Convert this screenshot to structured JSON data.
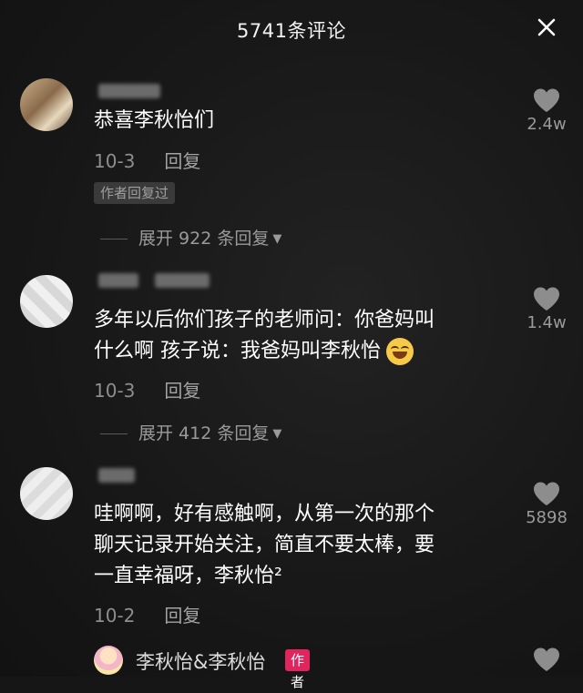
{
  "header": {
    "title": "5741条评论"
  },
  "comments": [
    {
      "text_lines": [
        "恭喜李秋怡们"
      ],
      "date": "10-3",
      "reply_label": "回复",
      "author_badge": "作者回复过",
      "expand_label": "展开 922 条回复",
      "likes": "2.4w"
    },
    {
      "text_lines": [
        "多年以后你们孩子的老师问：你爸妈叫",
        "什么啊 孩子说：我爸妈叫李秋怡"
      ],
      "date": "10-3",
      "reply_label": "回复",
      "expand_label": "展开 412 条回复",
      "likes": "1.4w"
    },
    {
      "text_lines": [
        "哇啊啊，好有感触啊，从第一次的那个",
        "聊天记录开始关注，简直不要太棒，要",
        "一直幸福呀，李秋怡²"
      ],
      "date": "10-2",
      "reply_label": "回复",
      "likes": "5898"
    }
  ],
  "author_reply": {
    "name": "李秋怡&李秋怡",
    "badge": "作者"
  },
  "icons": {
    "close": "close-icon",
    "like": "heart-icon",
    "emoji": "grin-emoji-icon",
    "expand": "caret-down-icon"
  },
  "colors": {
    "background": "#161616",
    "author_badge": "#e0245e"
  }
}
